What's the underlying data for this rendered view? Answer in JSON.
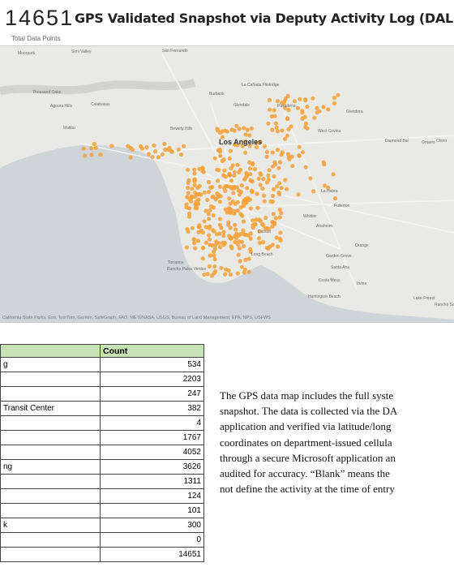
{
  "header": {
    "total_count": "14651",
    "title": "GPS Validated Snapshot via Deputy Activity Log (DAL) App",
    "subtitle": "Total Data Points"
  },
  "map": {
    "attribution": "California State Parks, Esri, TomTom, Garmin, SafeGraph, FAO, METI/NASA, USGS, Bureau of Land Management, EPA, NPS, USFWS",
    "place_labels": [
      "Moorpark",
      "Simi Valley",
      "San Fernando",
      "La Cañada Flintridge",
      "Burbank",
      "Glendale",
      "Pasadena",
      "Thousand Oaks",
      "Agoura Hills",
      "Calabasas",
      "Malibu",
      "Beverly Hills",
      "Los Angeles",
      "West Covina",
      "Glendora",
      "Diamond Bar",
      "Chino",
      "Ontario",
      "La Habra",
      "Whittier",
      "Fullerton",
      "Anaheim",
      "Orange",
      "Torrance",
      "Long Beach",
      "Garden Grove",
      "Santa Ana",
      "Irvine",
      "Rancho Palos Verdes",
      "Huntington Beach",
      "Costa Mesa",
      "Lake Forest",
      "Rancho Santa Margarita",
      "Carson"
    ],
    "point_color": "#f5a13a"
  },
  "table": {
    "headers": [
      "",
      "Count"
    ],
    "rows": [
      {
        "label": "g",
        "count": "534"
      },
      {
        "label": "",
        "count": "2203"
      },
      {
        "label": "",
        "count": "247"
      },
      {
        "label": "Transit Center",
        "count": "382"
      },
      {
        "label": "",
        "count": "4"
      },
      {
        "label": "",
        "count": "1767"
      },
      {
        "label": "",
        "count": "4052"
      },
      {
        "label": "ng",
        "count": "3626"
      },
      {
        "label": "",
        "count": "1311"
      },
      {
        "label": "",
        "count": "124"
      },
      {
        "label": "",
        "count": "101"
      },
      {
        "label": "k",
        "count": "300"
      },
      {
        "label": "",
        "count": "0"
      },
      {
        "label": "",
        "count": "14651"
      }
    ]
  },
  "description": {
    "lines": [
      "The GPS data map includes the full syste",
      "snapshot. The data is collected via the DA",
      "application and verified via latitude/long",
      "coordinates on department-issued cellula",
      "through a secure Microsoft application an",
      "audited for accuracy. “Blank” means the",
      "not define the activity at the time of entry"
    ]
  }
}
